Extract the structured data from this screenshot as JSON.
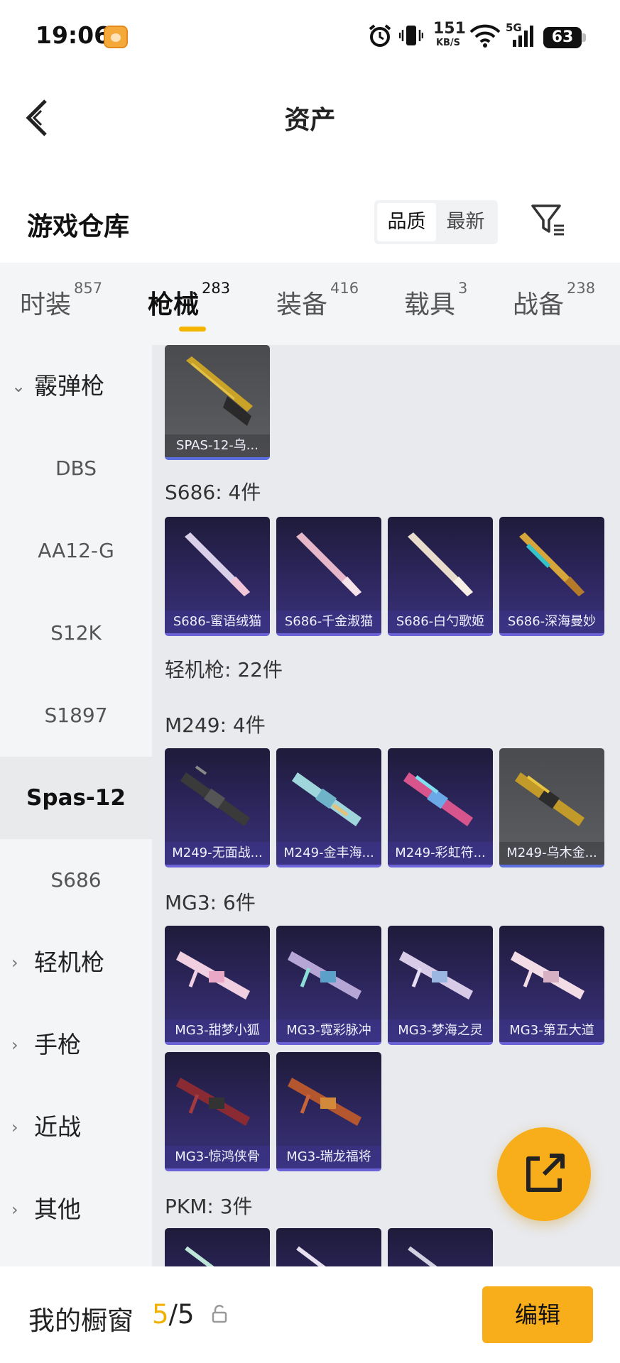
{
  "status_bar": {
    "time": "19:06",
    "net_speed": "151",
    "net_unit": "KB/S",
    "network": "5G",
    "battery": "63"
  },
  "header": {
    "title": "资产"
  },
  "warehouse": {
    "title": "游戏仓库",
    "sort_options": [
      "品质",
      "最新"
    ],
    "active_sort": "品质"
  },
  "tabs": [
    {
      "label": "时装",
      "count": "857"
    },
    {
      "label": "枪械",
      "count": "283"
    },
    {
      "label": "装备",
      "count": "416"
    },
    {
      "label": "载具",
      "count": "3"
    },
    {
      "label": "战备",
      "count": "238"
    }
  ],
  "active_tab": "枪械",
  "sidebar": [
    {
      "label": "霰弹枪",
      "type": "category",
      "expanded": true
    },
    {
      "label": "DBS"
    },
    {
      "label": "AA12-G"
    },
    {
      "label": "S12K"
    },
    {
      "label": "S1897"
    },
    {
      "label": "Spas-12",
      "active": true
    },
    {
      "label": "S686"
    },
    {
      "label": "轻机枪",
      "type": "category",
      "expanded": false
    },
    {
      "label": "手枪",
      "type": "category",
      "expanded": false
    },
    {
      "label": "近战",
      "type": "category",
      "expanded": false
    },
    {
      "label": "其他",
      "type": "category",
      "expanded": false
    }
  ],
  "sections": {
    "s686": "S686: 4件",
    "lmg": "轻机枪: 22件",
    "m249": "M249: 4件",
    "mg3": "MG3: 6件",
    "pkm": "PKM: 3件"
  },
  "items": {
    "spas": [
      "SPAS-12-乌..."
    ],
    "s686": [
      "S686-蜜语绒猫",
      "S686-千金淑猫",
      "S686-白勺歌姬",
      "S686-深海曼妙"
    ],
    "m249": [
      "M249-无面战...",
      "M249-金丰海...",
      "M249-彩虹符...",
      "M249-乌木金..."
    ],
    "mg3": [
      "MG3-甜梦小狐",
      "MG3-霓彩脉冲",
      "MG3-梦海之灵",
      "MG3-第五大道",
      "MG3-惊鸿侠骨",
      "MG3-瑞龙福将"
    ]
  },
  "showcase": {
    "label": "我的橱窗",
    "current": "5",
    "separator": "/",
    "total": "5",
    "edit_label": "编辑"
  },
  "colors": {
    "accent": "#f8ad1a",
    "card_purple": "#2e2760",
    "card_grey": "#5d5e62"
  }
}
